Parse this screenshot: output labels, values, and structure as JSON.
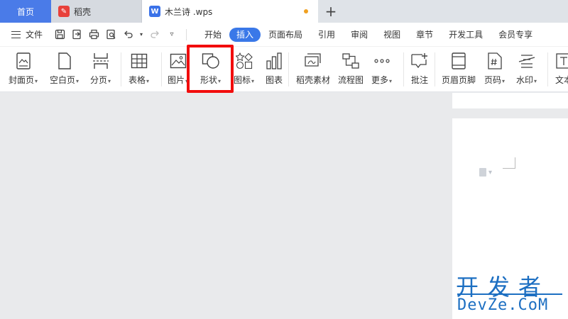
{
  "tabs": {
    "home": "首页",
    "daoke": "稻壳",
    "document": "木兰诗 .wps",
    "add": "+"
  },
  "menubar": {
    "file": "文件",
    "tabs": [
      "开始",
      "插入",
      "页面布局",
      "引用",
      "审阅",
      "视图",
      "章节",
      "开发工具",
      "会员专享"
    ],
    "active_tab": "插入"
  },
  "ribbon": {
    "items": [
      {
        "label": "封面页",
        "dropdown": true
      },
      {
        "label": "空白页",
        "dropdown": true
      },
      {
        "label": "分页",
        "dropdown": true
      },
      {
        "label": "表格",
        "dropdown": true
      },
      {
        "label": "图片",
        "dropdown": true
      },
      {
        "label": "形状",
        "dropdown": true
      },
      {
        "label": "图标",
        "dropdown": true
      },
      {
        "label": "图表",
        "dropdown": false
      },
      {
        "label": "稻壳素材",
        "dropdown": false
      },
      {
        "label": "流程图",
        "dropdown": true
      },
      {
        "label": "更多",
        "dropdown": true
      },
      {
        "label": "批注",
        "dropdown": false
      },
      {
        "label": "页眉页脚",
        "dropdown": false
      },
      {
        "label": "页码",
        "dropdown": true
      },
      {
        "label": "水印",
        "dropdown": true
      },
      {
        "label": "文本",
        "dropdown": false
      }
    ],
    "highlighted": "形状"
  },
  "watermark": {
    "line1": "开发者",
    "line2": "DevZe.CoM"
  },
  "colors": {
    "accent": "#3a78e8",
    "home_tab": "#4a7be8",
    "highlight": "#f20d0d",
    "unsaved_dot": "#f0a020",
    "watermark": "#1d6fc2"
  }
}
